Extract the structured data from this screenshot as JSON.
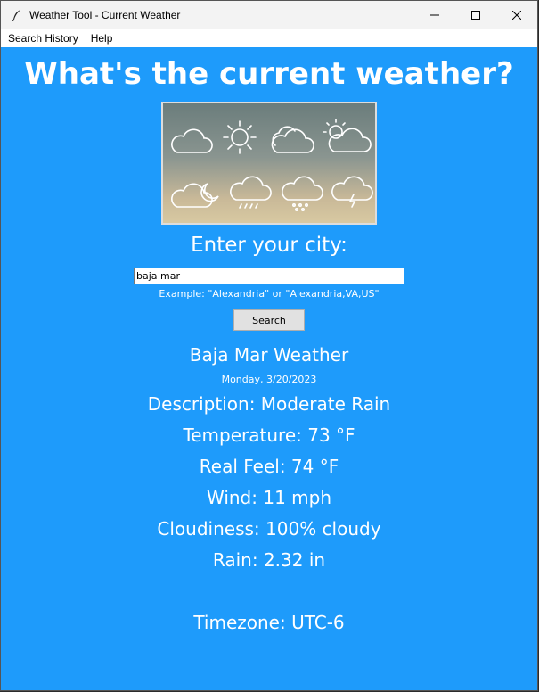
{
  "window": {
    "title": "Weather Tool - Current Weather"
  },
  "icons": {
    "app": "feather-icon",
    "minimize": "minimize-icon",
    "maximize": "maximize-icon",
    "close": "close-icon"
  },
  "menu": [
    "Search History",
    "Help"
  ],
  "heading": "What's the current weather?",
  "banner_icons": [
    "cloud-icon",
    "sun-icon",
    "clouds-icon",
    "partly-cloudy-icon",
    "cloud-moon-icon",
    "rain-cloud-icon",
    "snow-cloud-icon",
    "thunder-cloud-icon"
  ],
  "search": {
    "label": "Enter your city:",
    "value": "baja mar",
    "example": "Example: \"Alexandria\" or \"Alexandria,VA,US\"",
    "button": "Search"
  },
  "result": {
    "city_title": "Baja Mar Weather",
    "date": "Monday, 3/20/2023",
    "lines": [
      "Description:   Moderate Rain",
      "Temperature:   73 °F",
      "Real Feel:   74 °F",
      "Wind:   11 mph",
      "Cloudiness:   100% cloudy",
      "Rain:   2.32 in",
      "Timezone:   UTC-6"
    ]
  },
  "colors": {
    "background": "#1e9bfb",
    "text": "#ffffff"
  }
}
